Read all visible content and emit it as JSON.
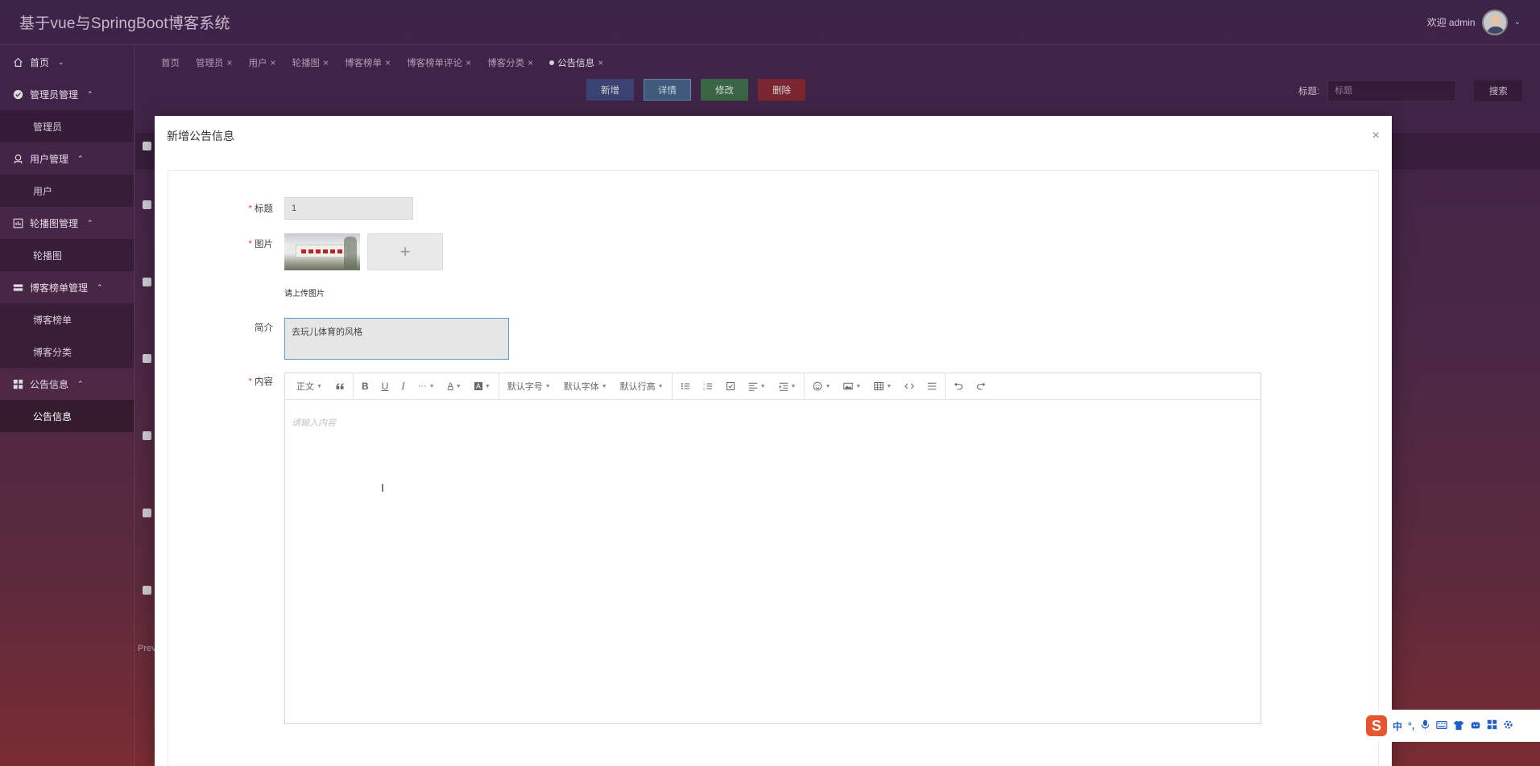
{
  "header": {
    "app_title": "基于vue与SpringBoot博客系统",
    "welcome": "欢迎 admin"
  },
  "sidebar": {
    "groups": [
      {
        "label": "首页",
        "icon": "home-icon",
        "children": []
      },
      {
        "label": "管理员管理",
        "icon": "check-circle-icon",
        "children": [
          "管理员"
        ]
      },
      {
        "label": "用户管理",
        "icon": "user-icon",
        "children": [
          "用户"
        ]
      },
      {
        "label": "轮播图管理",
        "icon": "grid-chart-icon",
        "children": [
          "轮播图"
        ]
      },
      {
        "label": "博客榜单管理",
        "icon": "table-icon",
        "children": [
          "博客榜单",
          "博客分类"
        ]
      },
      {
        "label": "公告信息",
        "icon": "apps-icon",
        "children": [
          "公告信息"
        ]
      }
    ]
  },
  "tabs": [
    {
      "label": "首页",
      "closable": false
    },
    {
      "label": "管理员",
      "closable": true
    },
    {
      "label": "用户",
      "closable": true
    },
    {
      "label": "轮播图",
      "closable": true
    },
    {
      "label": "博客榜单",
      "closable": true
    },
    {
      "label": "博客榜单评论",
      "closable": true
    },
    {
      "label": "博客分类",
      "closable": true
    },
    {
      "label": "公告信息",
      "closable": true,
      "active": true
    }
  ],
  "actions": {
    "add": "新增",
    "detail": "详情",
    "edit": "修改",
    "delete": "删除"
  },
  "search": {
    "label": "标题:",
    "placeholder": "标题",
    "button": "搜索"
  },
  "pager_text": "Prev",
  "modal": {
    "title": "新增公告信息",
    "close": "×",
    "fields": {
      "title_label": "标题",
      "title_value": "1",
      "image_label": "图片",
      "upload_plus": "+",
      "upload_tip": "请上传图片",
      "intro_label": "简介",
      "intro_value": "去玩儿体育的风格",
      "content_label": "内容",
      "content_placeholder": "请输入内容"
    },
    "toolbar": {
      "paragraph": "正文",
      "font_size": "默认字号",
      "font_family": "默认字体",
      "line_height": "默认行高"
    }
  },
  "ime": {
    "items": [
      "中",
      "°,"
    ]
  },
  "colors": {
    "btn_add": "#3b4373",
    "btn_detail": "#3f5a7a",
    "btn_edit": "#3a6545",
    "btn_delete": "#7a2530",
    "required": "#e0444a"
  }
}
